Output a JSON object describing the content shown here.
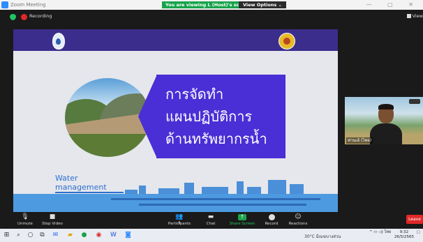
{
  "window": {
    "title": "Zoom Meeting",
    "viewing_banner": "You are viewing L (Host)'s screen",
    "view_options": "View Options ⌄",
    "controls": "— ▢ ✕"
  },
  "topbar": {
    "recording_label": "Recording",
    "view_label": "View"
  },
  "slide": {
    "title_lines": [
      "การจัดทำ",
      "แผนปฏิบัติการ",
      "ด้านทรัพยากรน้ำ"
    ],
    "water_label_line1": "Water",
    "water_label_line2": "management"
  },
  "participant": {
    "name": "ท่านเอ้ (ไทย)"
  },
  "toolbar": {
    "unmute": "Unmute",
    "stop_video": "Stop Video",
    "participants": "Participants",
    "participants_count": "6",
    "chat": "Chat",
    "share_screen": "Share Screen",
    "record": "Record",
    "reactions": "Reactions",
    "leave": "Leave"
  },
  "taskbar": {
    "weather": "30°C  มีเมฆบางส่วน",
    "lang": "ไทย",
    "time": "9:32",
    "date": "26/5/2565"
  },
  "colors": {
    "slide_header": "#3b2d8c",
    "title_box": "#4a2ed6",
    "banner_green": "#16a34a",
    "leave_red": "#e02828"
  }
}
